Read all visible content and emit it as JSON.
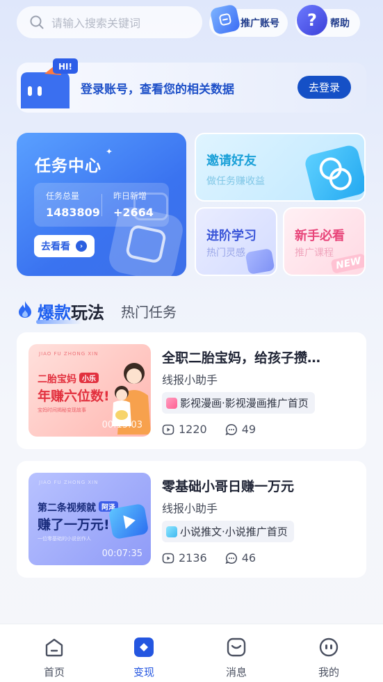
{
  "search": {
    "placeholder": "请输入搜索关键词"
  },
  "header": {
    "promo_label": "推广账号",
    "help_label": "帮助"
  },
  "login_banner": {
    "badge": "HI!",
    "message": "登录账号，查看您的相关数据",
    "button": "去登录"
  },
  "task_center": {
    "title": "任务中心",
    "stats": [
      {
        "label": "任务总量",
        "value": "1483809"
      },
      {
        "label": "昨日新增",
        "value": "+2664"
      }
    ],
    "button": "去看看"
  },
  "cards": {
    "invite": {
      "title": "邀请好友",
      "subtitle": "做任务赚收益"
    },
    "learn": {
      "title": "进阶学习",
      "subtitle": "热门灵感"
    },
    "newbie": {
      "title": "新手必看",
      "subtitle": "推广课程",
      "badge": "NEW"
    }
  },
  "section": {
    "title_highlight": "爆款",
    "title_rest": "玩法",
    "tab": "热门任务"
  },
  "videos": [
    {
      "thumb_tiny": "JIAO FU ZHONG XIN",
      "thumb_line1": "二胎宝妈",
      "thumb_tag": "小乐",
      "thumb_line2": "年赚六位数!",
      "thumb_line3": "宝妈时间揭秘变现故事",
      "duration": "00:13:03",
      "title": "全职二胎宝妈，给孩子攒…",
      "author": "线报小助手",
      "category": "影视漫画·影视漫画推广首页",
      "views": "1220",
      "comments": "49"
    },
    {
      "thumb_tiny": "JIAO FU ZHONG XIN",
      "thumb_line1": "第二条视频就",
      "thumb_tag": "阿泽",
      "thumb_line2": "赚了一万元!",
      "thumb_line3": "一位零基础的小说创作人",
      "duration": "00:07:35",
      "title": "零基础小哥日赚一万元",
      "author": "线报小助手",
      "category": "小说推文·小说推广首页",
      "views": "2136",
      "comments": "46"
    }
  ],
  "nav": [
    {
      "label": "首页",
      "icon": "home-icon"
    },
    {
      "label": "变现",
      "icon": "monetize-icon"
    },
    {
      "label": "消息",
      "icon": "message-icon"
    },
    {
      "label": "我的",
      "icon": "profile-icon"
    }
  ],
  "colors": {
    "primary": "#1550c6",
    "accent": "#1f60f0",
    "pink": "#e8457a"
  }
}
